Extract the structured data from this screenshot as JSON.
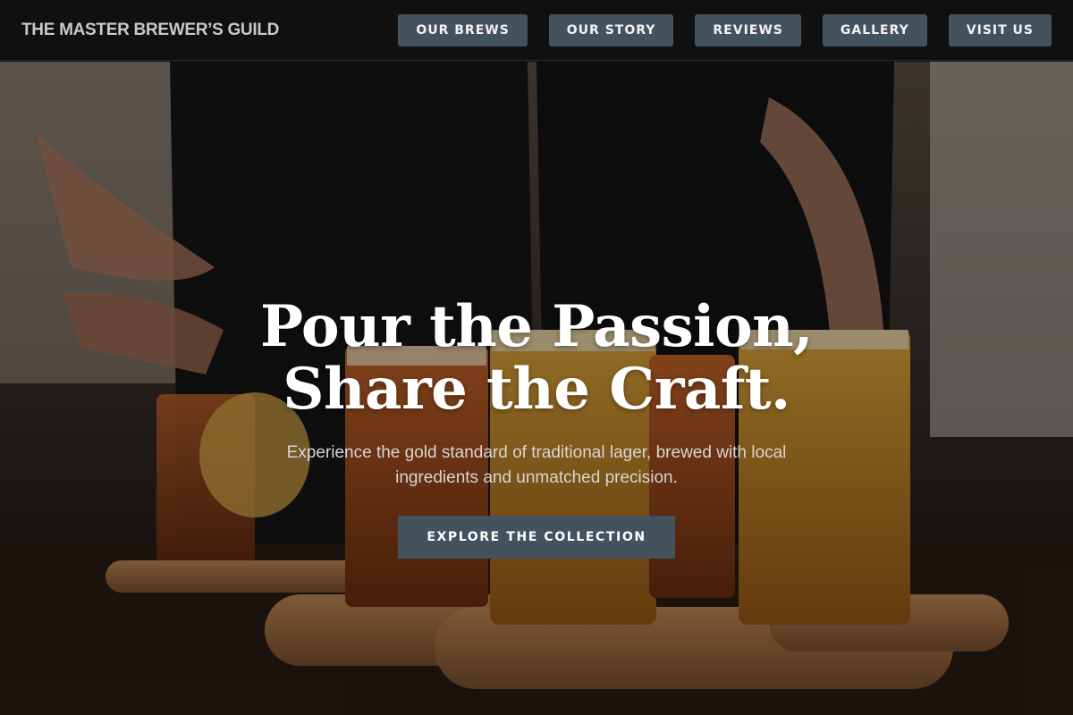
{
  "header": {
    "brand": "THE MASTER BREWER’S GUILD",
    "nav": [
      {
        "label": "OUR BREWS"
      },
      {
        "label": "OUR STORY"
      },
      {
        "label": "REVIEWS"
      },
      {
        "label": "GALLERY"
      },
      {
        "label": "VISIT US"
      }
    ]
  },
  "hero": {
    "headline_line1": "Pour the Passion,",
    "headline_line2": "Share the Craft.",
    "subhead": "Experience the gold standard of traditional lager, brewed with local ingredients and unmatched precision.",
    "cta_label": "EXPLORE THE COLLECTION"
  },
  "colors": {
    "header_bg": "#101010",
    "button_bg": "#44525e",
    "brand_text": "#c9c9c9"
  }
}
